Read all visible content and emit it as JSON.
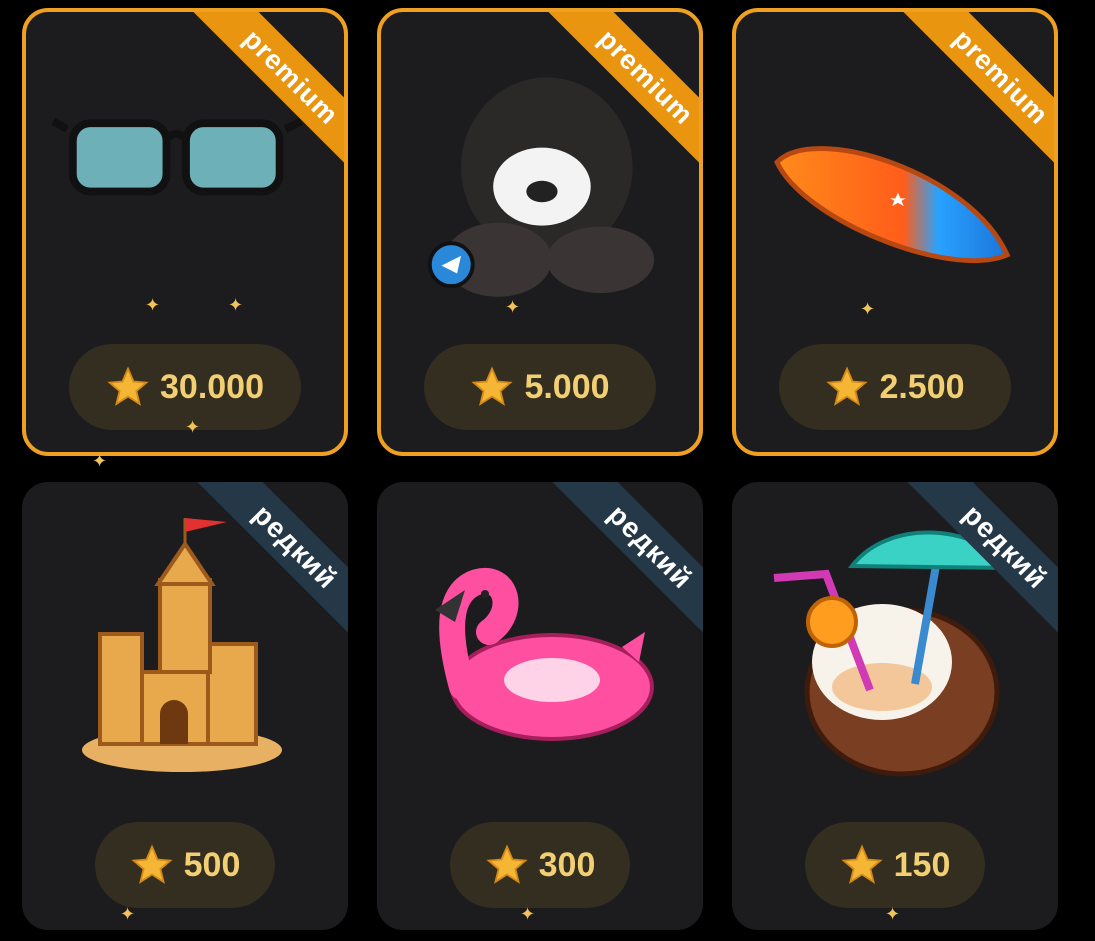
{
  "cards": [
    {
      "badge": "premium",
      "price": "30.000",
      "item": "sunglasses"
    },
    {
      "badge": "premium",
      "price": "5.000",
      "item": "hooded-teddy-bear"
    },
    {
      "badge": "premium",
      "price": "2.500",
      "item": "surfboard"
    },
    {
      "badge": "редкий",
      "price": "500",
      "item": "sandcastle"
    },
    {
      "badge": "редкий",
      "price": "300",
      "item": "flamingo-float"
    },
    {
      "badge": "редкий",
      "price": "150",
      "item": "coconut-cocktail"
    }
  ],
  "icons": {
    "price": "star-icon"
  },
  "colors": {
    "premium": "#e9950f",
    "rare": "#243848",
    "price_text": "#f3cf74"
  }
}
